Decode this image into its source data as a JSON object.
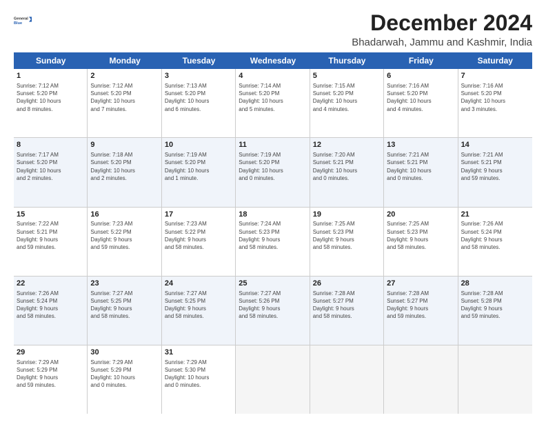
{
  "logo": {
    "line1": "General",
    "line2": "Blue"
  },
  "title": "December 2024",
  "location": "Bhadarwah, Jammu and Kashmir, India",
  "days_of_week": [
    "Sunday",
    "Monday",
    "Tuesday",
    "Wednesday",
    "Thursday",
    "Friday",
    "Saturday"
  ],
  "weeks": [
    [
      {
        "day": "1",
        "info": "Sunrise: 7:12 AM\nSunset: 5:20 PM\nDaylight: 10 hours\nand 8 minutes."
      },
      {
        "day": "2",
        "info": "Sunrise: 7:12 AM\nSunset: 5:20 PM\nDaylight: 10 hours\nand 7 minutes."
      },
      {
        "day": "3",
        "info": "Sunrise: 7:13 AM\nSunset: 5:20 PM\nDaylight: 10 hours\nand 6 minutes."
      },
      {
        "day": "4",
        "info": "Sunrise: 7:14 AM\nSunset: 5:20 PM\nDaylight: 10 hours\nand 5 minutes."
      },
      {
        "day": "5",
        "info": "Sunrise: 7:15 AM\nSunset: 5:20 PM\nDaylight: 10 hours\nand 4 minutes."
      },
      {
        "day": "6",
        "info": "Sunrise: 7:16 AM\nSunset: 5:20 PM\nDaylight: 10 hours\nand 4 minutes."
      },
      {
        "day": "7",
        "info": "Sunrise: 7:16 AM\nSunset: 5:20 PM\nDaylight: 10 hours\nand 3 minutes."
      }
    ],
    [
      {
        "day": "8",
        "info": "Sunrise: 7:17 AM\nSunset: 5:20 PM\nDaylight: 10 hours\nand 2 minutes."
      },
      {
        "day": "9",
        "info": "Sunrise: 7:18 AM\nSunset: 5:20 PM\nDaylight: 10 hours\nand 2 minutes."
      },
      {
        "day": "10",
        "info": "Sunrise: 7:19 AM\nSunset: 5:20 PM\nDaylight: 10 hours\nand 1 minute."
      },
      {
        "day": "11",
        "info": "Sunrise: 7:19 AM\nSunset: 5:20 PM\nDaylight: 10 hours\nand 0 minutes."
      },
      {
        "day": "12",
        "info": "Sunrise: 7:20 AM\nSunset: 5:21 PM\nDaylight: 10 hours\nand 0 minutes."
      },
      {
        "day": "13",
        "info": "Sunrise: 7:21 AM\nSunset: 5:21 PM\nDaylight: 10 hours\nand 0 minutes."
      },
      {
        "day": "14",
        "info": "Sunrise: 7:21 AM\nSunset: 5:21 PM\nDaylight: 9 hours\nand 59 minutes."
      }
    ],
    [
      {
        "day": "15",
        "info": "Sunrise: 7:22 AM\nSunset: 5:21 PM\nDaylight: 9 hours\nand 59 minutes."
      },
      {
        "day": "16",
        "info": "Sunrise: 7:23 AM\nSunset: 5:22 PM\nDaylight: 9 hours\nand 59 minutes."
      },
      {
        "day": "17",
        "info": "Sunrise: 7:23 AM\nSunset: 5:22 PM\nDaylight: 9 hours\nand 58 minutes."
      },
      {
        "day": "18",
        "info": "Sunrise: 7:24 AM\nSunset: 5:23 PM\nDaylight: 9 hours\nand 58 minutes."
      },
      {
        "day": "19",
        "info": "Sunrise: 7:25 AM\nSunset: 5:23 PM\nDaylight: 9 hours\nand 58 minutes."
      },
      {
        "day": "20",
        "info": "Sunrise: 7:25 AM\nSunset: 5:23 PM\nDaylight: 9 hours\nand 58 minutes."
      },
      {
        "day": "21",
        "info": "Sunrise: 7:26 AM\nSunset: 5:24 PM\nDaylight: 9 hours\nand 58 minutes."
      }
    ],
    [
      {
        "day": "22",
        "info": "Sunrise: 7:26 AM\nSunset: 5:24 PM\nDaylight: 9 hours\nand 58 minutes."
      },
      {
        "day": "23",
        "info": "Sunrise: 7:27 AM\nSunset: 5:25 PM\nDaylight: 9 hours\nand 58 minutes."
      },
      {
        "day": "24",
        "info": "Sunrise: 7:27 AM\nSunset: 5:25 PM\nDaylight: 9 hours\nand 58 minutes."
      },
      {
        "day": "25",
        "info": "Sunrise: 7:27 AM\nSunset: 5:26 PM\nDaylight: 9 hours\nand 58 minutes."
      },
      {
        "day": "26",
        "info": "Sunrise: 7:28 AM\nSunset: 5:27 PM\nDaylight: 9 hours\nand 58 minutes."
      },
      {
        "day": "27",
        "info": "Sunrise: 7:28 AM\nSunset: 5:27 PM\nDaylight: 9 hours\nand 59 minutes."
      },
      {
        "day": "28",
        "info": "Sunrise: 7:28 AM\nSunset: 5:28 PM\nDaylight: 9 hours\nand 59 minutes."
      }
    ],
    [
      {
        "day": "29",
        "info": "Sunrise: 7:29 AM\nSunset: 5:29 PM\nDaylight: 9 hours\nand 59 minutes."
      },
      {
        "day": "30",
        "info": "Sunrise: 7:29 AM\nSunset: 5:29 PM\nDaylight: 10 hours\nand 0 minutes."
      },
      {
        "day": "31",
        "info": "Sunrise: 7:29 AM\nSunset: 5:30 PM\nDaylight: 10 hours\nand 0 minutes."
      },
      {
        "day": "",
        "info": ""
      },
      {
        "day": "",
        "info": ""
      },
      {
        "day": "",
        "info": ""
      },
      {
        "day": "",
        "info": ""
      }
    ]
  ]
}
